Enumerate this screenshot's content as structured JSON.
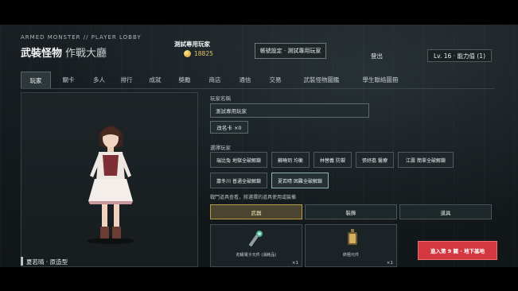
{
  "header": {
    "eyebrow": "ARMED MONSTER // PLAYER LOBBY",
    "title": "武裝怪物",
    "subtitle": "作戰大廳",
    "player_name": "測試專用玩家",
    "coins": "18825",
    "bind_button": "帳號設定 · 測試專用玩家",
    "logout": "登出",
    "level": "Lv. 16 · 能力值 (1)"
  },
  "tabs": [
    "玩家",
    "關卡",
    "多人",
    "排行",
    "成就",
    "獎勵",
    "商店",
    "通信",
    "交易",
    "武裝怪物圖鑑",
    "學生聯絡圖冊"
  ],
  "active_tab": "玩家",
  "character": {
    "name": "夏若晴 · 原造型"
  },
  "profile": {
    "name_label": "玩家名稱",
    "name_value": "測試專用玩家",
    "rename_button": "改名卡 ×0",
    "select_label": "選擇玩家",
    "players": [
      "瑞比兔 地獄全破解鎖",
      "蘇曉玥 均衡",
      "林替義 防禦",
      "張妤荔 醫療",
      "江震 簡單全破解鎖",
      "蕭冬川 普通全破解鎖",
      "夏若晴 困難全破解鎖"
    ],
    "active_player": "夏若晴 困難全破解鎖",
    "equip_hint": "戰鬥道具查看，將選擇的道具使用或裝備"
  },
  "categories": [
    "武器",
    "裝飾",
    "道具"
  ],
  "active_category": "武器",
  "items": [
    {
      "name": "初級電子元件 (消耗品)",
      "qty": "×1"
    },
    {
      "name": "終極元件",
      "qty": "×1"
    }
  ],
  "enter_button": "進入第 9 關 · 地下基地",
  "colors": {
    "accent_red": "#d33840",
    "accent_gold": "#b99b4a",
    "panel_bg": "#1b2326"
  }
}
